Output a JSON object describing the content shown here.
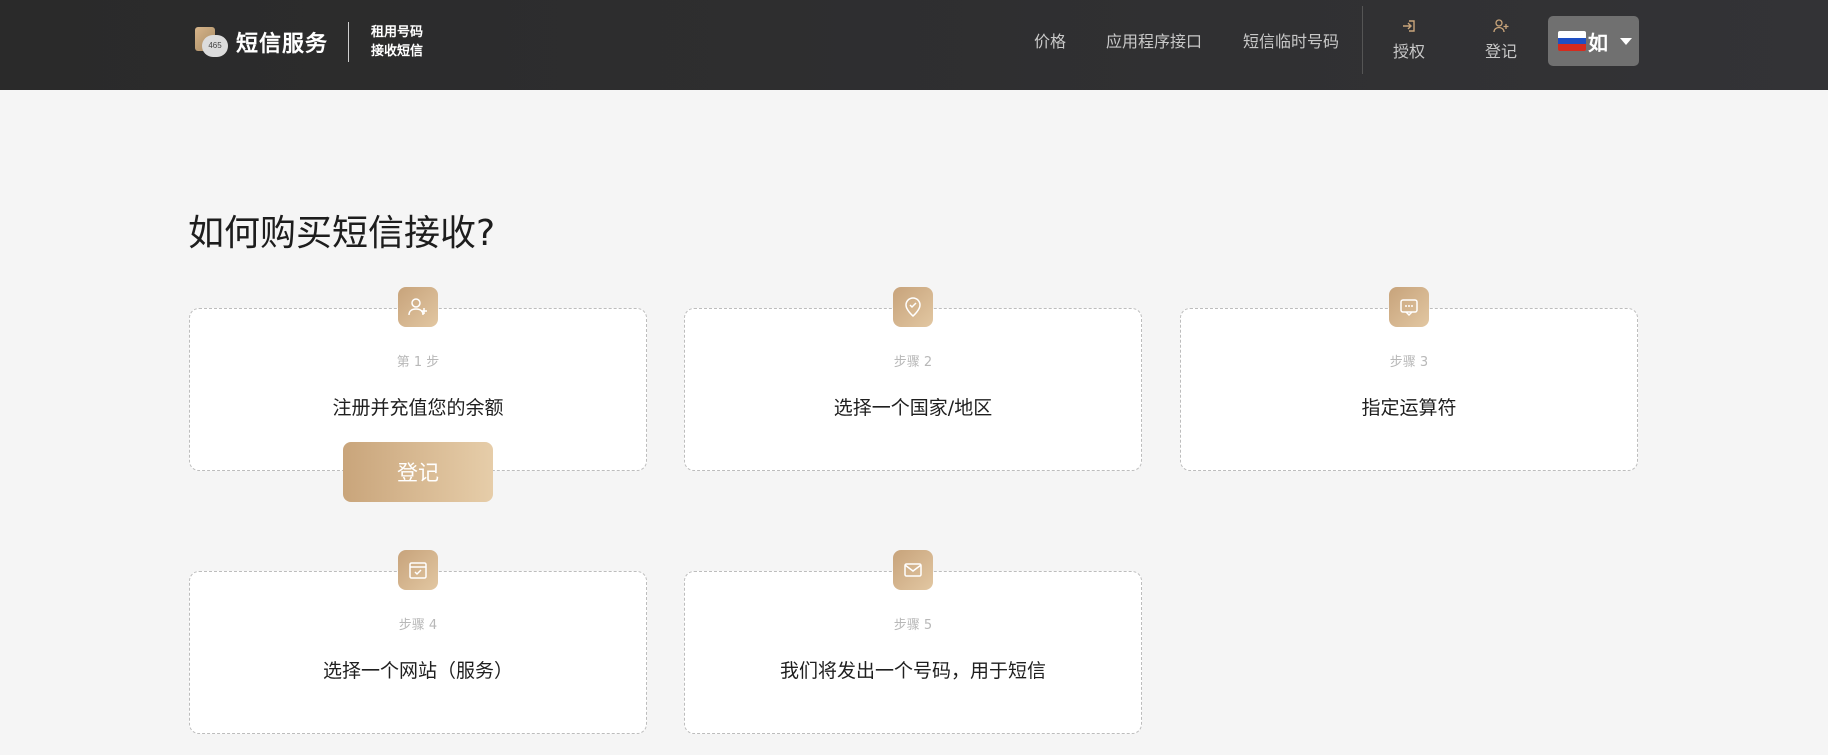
{
  "header": {
    "logo_badge": "465",
    "brand": "短信服务",
    "tagline_line1": "租用号码",
    "tagline_line2": "接收短信",
    "nav": [
      "价格",
      "应用程序接口",
      "短信临时号码"
    ],
    "login_label": "授权",
    "register_label": "登记",
    "language_label": "如",
    "accent_color": "#c9a57b"
  },
  "main": {
    "heading": "如何购买短信接收?",
    "steps": [
      {
        "step": "第 1 步",
        "title": "注册并充值您的余额",
        "icon": "user-plus-icon"
      },
      {
        "step": "步骤 2",
        "title": "选择一个国家/地区",
        "icon": "map-pin-check-icon"
      },
      {
        "step": "步骤 3",
        "title": "指定运算符",
        "icon": "chat-icon"
      },
      {
        "step": "步骤 4",
        "title": "选择一个网站（服务）",
        "icon": "calendar-check-icon"
      },
      {
        "step": "步骤 5",
        "title": "我们将发出一个号码，用于短信",
        "icon": "mail-icon"
      }
    ],
    "register_button": "登记"
  }
}
